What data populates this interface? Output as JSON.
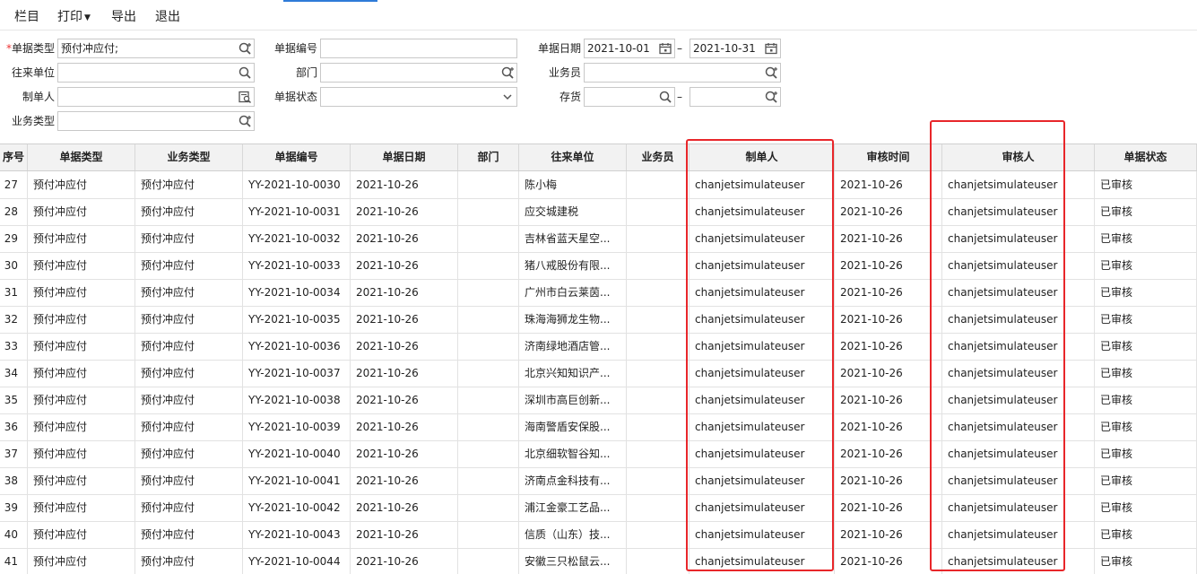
{
  "toolbar": {
    "items": [
      "栏目",
      "打印",
      "导出",
      "退出"
    ]
  },
  "filters": {
    "doc_type": {
      "label": "单据类型",
      "value": "预付冲应付;"
    },
    "doc_no": {
      "label": "单据编号",
      "value": ""
    },
    "doc_date": {
      "label": "单据日期",
      "from": "2021-10-01",
      "to": "2021-10-31"
    },
    "partner": {
      "label": "往来单位",
      "value": ""
    },
    "dept": {
      "label": "部门",
      "value": ""
    },
    "salesman": {
      "label": "业务员",
      "value": ""
    },
    "creator": {
      "label": "制单人",
      "value": ""
    },
    "status": {
      "label": "单据状态",
      "value": ""
    },
    "inventory": {
      "label": "存货",
      "from": "",
      "to": ""
    },
    "biz_type": {
      "label": "业务类型",
      "value": ""
    },
    "range_sep": "–"
  },
  "table": {
    "columns": [
      "序号",
      "单据类型",
      "业务类型",
      "单据编号",
      "单据日期",
      "部门",
      "往来单位",
      "业务员",
      "制单人",
      "审核时间",
      "审核人",
      "单据状态"
    ],
    "rows": [
      [
        "27",
        "预付冲应付",
        "预付冲应付",
        "YY-2021-10-0030",
        "2021-10-26",
        "",
        "陈小梅",
        "",
        "chanjetsimulateuser",
        "2021-10-26",
        "chanjetsimulateuser",
        "已审核"
      ],
      [
        "28",
        "预付冲应付",
        "预付冲应付",
        "YY-2021-10-0031",
        "2021-10-26",
        "",
        "应交城建税",
        "",
        "chanjetsimulateuser",
        "2021-10-26",
        "chanjetsimulateuser",
        "已审核"
      ],
      [
        "29",
        "预付冲应付",
        "预付冲应付",
        "YY-2021-10-0032",
        "2021-10-26",
        "",
        "吉林省蓝天星空...",
        "",
        "chanjetsimulateuser",
        "2021-10-26",
        "chanjetsimulateuser",
        "已审核"
      ],
      [
        "30",
        "预付冲应付",
        "预付冲应付",
        "YY-2021-10-0033",
        "2021-10-26",
        "",
        "猪八戒股份有限...",
        "",
        "chanjetsimulateuser",
        "2021-10-26",
        "chanjetsimulateuser",
        "已审核"
      ],
      [
        "31",
        "预付冲应付",
        "预付冲应付",
        "YY-2021-10-0034",
        "2021-10-26",
        "",
        "广州市白云莱茵...",
        "",
        "chanjetsimulateuser",
        "2021-10-26",
        "chanjetsimulateuser",
        "已审核"
      ],
      [
        "32",
        "预付冲应付",
        "预付冲应付",
        "YY-2021-10-0035",
        "2021-10-26",
        "",
        "珠海海狮龙生物...",
        "",
        "chanjetsimulateuser",
        "2021-10-26",
        "chanjetsimulateuser",
        "已审核"
      ],
      [
        "33",
        "预付冲应付",
        "预付冲应付",
        "YY-2021-10-0036",
        "2021-10-26",
        "",
        "济南绿地酒店管...",
        "",
        "chanjetsimulateuser",
        "2021-10-26",
        "chanjetsimulateuser",
        "已审核"
      ],
      [
        "34",
        "预付冲应付",
        "预付冲应付",
        "YY-2021-10-0037",
        "2021-10-26",
        "",
        "北京兴知知识产...",
        "",
        "chanjetsimulateuser",
        "2021-10-26",
        "chanjetsimulateuser",
        "已审核"
      ],
      [
        "35",
        "预付冲应付",
        "预付冲应付",
        "YY-2021-10-0038",
        "2021-10-26",
        "",
        "深圳市高巨创新...",
        "",
        "chanjetsimulateuser",
        "2021-10-26",
        "chanjetsimulateuser",
        "已审核"
      ],
      [
        "36",
        "预付冲应付",
        "预付冲应付",
        "YY-2021-10-0039",
        "2021-10-26",
        "",
        "海南警盾安保股...",
        "",
        "chanjetsimulateuser",
        "2021-10-26",
        "chanjetsimulateuser",
        "已审核"
      ],
      [
        "37",
        "预付冲应付",
        "预付冲应付",
        "YY-2021-10-0040",
        "2021-10-26",
        "",
        "北京细软智谷知...",
        "",
        "chanjetsimulateuser",
        "2021-10-26",
        "chanjetsimulateuser",
        "已审核"
      ],
      [
        "38",
        "预付冲应付",
        "预付冲应付",
        "YY-2021-10-0041",
        "2021-10-26",
        "",
        "济南点金科技有...",
        "",
        "chanjetsimulateuser",
        "2021-10-26",
        "chanjetsimulateuser",
        "已审核"
      ],
      [
        "39",
        "预付冲应付",
        "预付冲应付",
        "YY-2021-10-0042",
        "2021-10-26",
        "",
        "浦江金豪工艺品...",
        "",
        "chanjetsimulateuser",
        "2021-10-26",
        "chanjetsimulateuser",
        "已审核"
      ],
      [
        "40",
        "预付冲应付",
        "预付冲应付",
        "YY-2021-10-0043",
        "2021-10-26",
        "",
        "信质（山东）技...",
        "",
        "chanjetsimulateuser",
        "2021-10-26",
        "chanjetsimulateuser",
        "已审核"
      ],
      [
        "41",
        "预付冲应付",
        "预付冲应付",
        "YY-2021-10-0044",
        "2021-10-26",
        "",
        "安徽三只松鼠云...",
        "",
        "chanjetsimulateuser",
        "2021-10-26",
        "chanjetsimulateuser",
        "已审核"
      ]
    ]
  },
  "colors": {
    "highlight": "#e8262a",
    "accent": "#2f7bd8",
    "header_bg": "#f2f2f2"
  }
}
